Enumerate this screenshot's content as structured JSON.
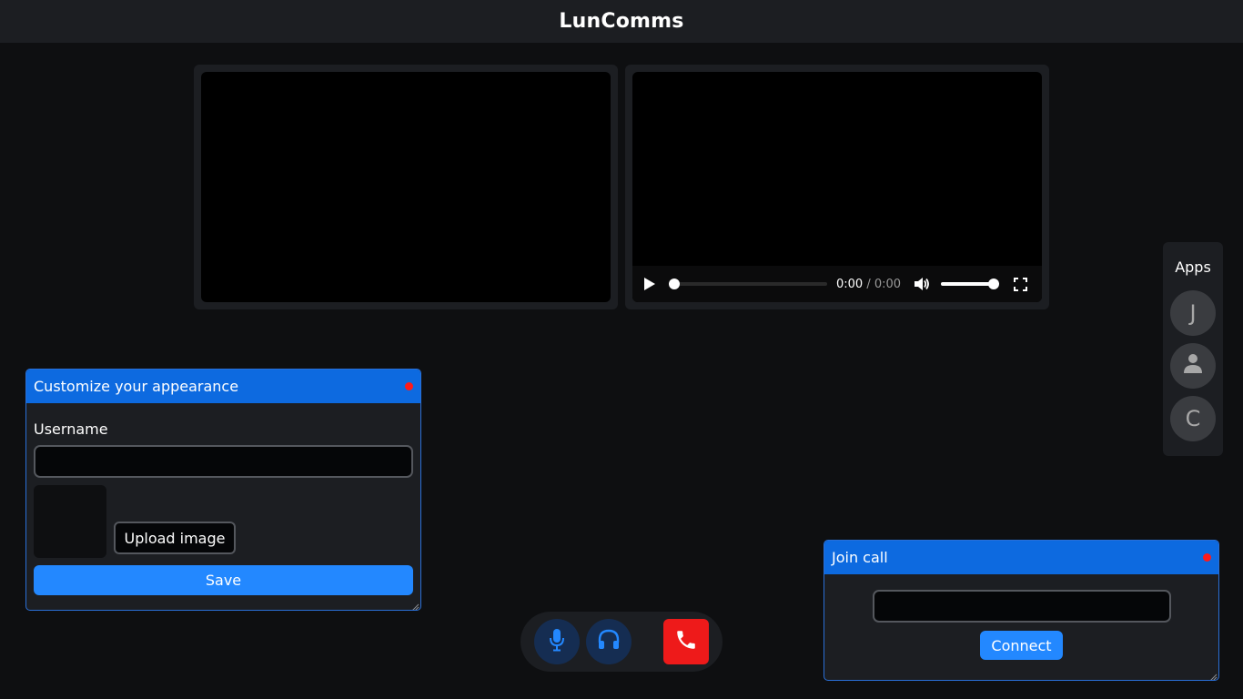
{
  "app": {
    "title": "LunComms"
  },
  "video_remote": {
    "time_current": "0:00",
    "time_separator": "/",
    "time_duration": "0:00"
  },
  "apps": {
    "label": "Apps",
    "items": [
      {
        "initial": "J",
        "icon": "letter-j"
      },
      {
        "initial": "",
        "icon": "user-icon"
      },
      {
        "initial": "C",
        "icon": "letter-c"
      }
    ]
  },
  "appearance_panel": {
    "title": "Customize your appearance",
    "username_label": "Username",
    "username_value": "",
    "upload_label": "Upload image",
    "save_label": "Save"
  },
  "join_panel": {
    "title": "Join call",
    "input_value": "",
    "connect_label": "Connect"
  },
  "call_controls": {
    "mic": "microphone-icon",
    "headphones": "headphones-icon",
    "hangup": "phone-hangup-icon"
  },
  "colors": {
    "accent": "#2388ff",
    "panel_header": "#0d6ae0",
    "danger": "#ee1a1a",
    "background": "#0e0f11",
    "surface": "#1c1e22"
  }
}
